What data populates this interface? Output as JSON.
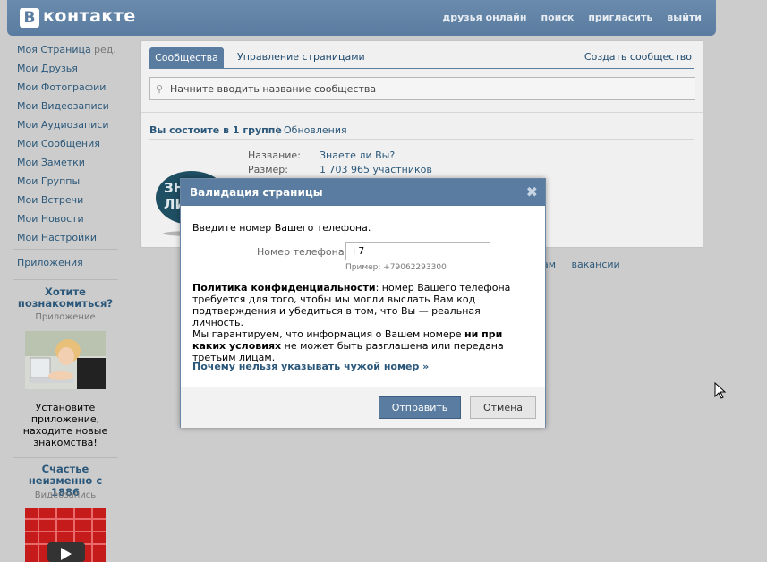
{
  "header": {
    "logo_letter": "В",
    "logo_text": "контакте",
    "nav": [
      "друзья онлайн",
      "поиск",
      "пригласить",
      "выйти"
    ]
  },
  "sidebar": {
    "edit_label": "ред.",
    "items": [
      {
        "label": "Моя Страница"
      },
      {
        "label": "Мои Друзья"
      },
      {
        "label": "Мои Фотографии"
      },
      {
        "label": "Мои Видеозаписи"
      },
      {
        "label": "Мои Аудиозаписи"
      },
      {
        "label": "Мои Сообщения"
      },
      {
        "label": "Мои Заметки"
      },
      {
        "label": "Мои Группы"
      },
      {
        "label": "Мои Встречи"
      },
      {
        "label": "Мои Новости"
      },
      {
        "label": "Мои Настройки"
      }
    ],
    "apps_label": "Приложения",
    "promo1": {
      "title": "Хотите познакомиться?",
      "subtitle": "Приложение",
      "text": "Установите приложение, находите новые знакомства!"
    },
    "promo2": {
      "title": "Счастье неизменно с 1886",
      "subtitle": "Видеозапись"
    }
  },
  "main": {
    "tabs": [
      {
        "label": "Сообщества"
      },
      {
        "label": "Управление страницами"
      }
    ],
    "create_link": "Создать сообщество",
    "search_placeholder": "Начните вводить название сообщества",
    "groups_count": "Вы состоите в 1 группе",
    "updates_link": "Обновления",
    "group": {
      "name_label": "Название:",
      "name_value": "Знаете ли Вы?",
      "size_label": "Размер:",
      "size_value": "1 703 965 участников"
    },
    "footer_links": "ам вакансии"
  },
  "modal": {
    "title": "Валидация страницы",
    "close": "✖",
    "intro": "Введите номер Вашего телефона.",
    "phone_label": "Номер телефона:",
    "phone_value": "+7",
    "phone_example": "Пример: +79062293300",
    "policy_bold": "Политика конфиденциальности",
    "policy_text": ": номер Вашего телефона требуется для того, чтобы мы могли выслать Вам код подтверждения и убедиться в том, что Вы — реальная личность.",
    "guarantee_pre": "Мы гарантируем, что информация о Вашем номере ",
    "guarantee_bold": "ни при каких условиях",
    "guarantee_post": " не может быть разглашена или передана третьим лицам.",
    "why_link": "Почему нельзя указывать чужой номер »",
    "send_button": "Отправить",
    "cancel_button": "Отмена"
  },
  "colors": {
    "brand": "#5a7ca0",
    "link": "#2b587a",
    "backdrop": "#cccccc"
  }
}
